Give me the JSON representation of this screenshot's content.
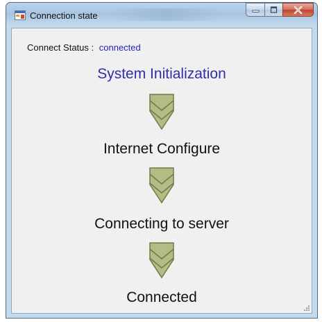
{
  "window": {
    "title": "Connection state",
    "icon": "app-window-icon",
    "buttons": {
      "minimize": "minimize-icon",
      "maximize": "maximize-icon",
      "close": "close-icon"
    }
  },
  "status": {
    "label": "Connect Status :",
    "value": "connected"
  },
  "steps": [
    "System Initialization",
    "Internet Configure",
    "Connecting to server",
    "Connected"
  ],
  "colors": {
    "active_step": "#2e2ea8",
    "status_value": "#2222bb",
    "arrow_fill": "#b4bb85",
    "arrow_stroke": "#6f7a44"
  }
}
